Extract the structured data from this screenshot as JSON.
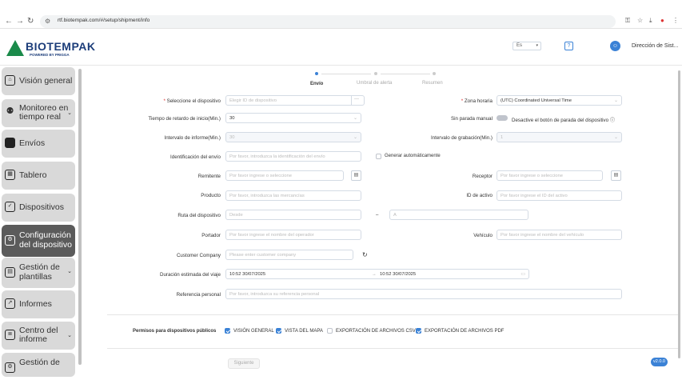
{
  "browser": {
    "url": "rtf.biotempak.com/#/setup/shipment/info"
  },
  "header": {
    "brand": "BIOTEMPAK",
    "tagline": "POWERED BY PRIGGA",
    "lang": "Es",
    "help": "?",
    "user": "Dirección de Sist..."
  },
  "sidebar": {
    "items": [
      {
        "label": "Visión general"
      },
      {
        "label": "Monitoreo en",
        "label2": "tiempo real"
      },
      {
        "label": "Envíos"
      },
      {
        "label": "Tablero"
      },
      {
        "label": "Dispositivos"
      },
      {
        "label": "Configuración",
        "label2": "del dispositivo"
      },
      {
        "label": "Gestión de",
        "label2": "plantillas"
      },
      {
        "label": "Informes"
      },
      {
        "label": "Centro del",
        "label2": "informe"
      },
      {
        "label": "Gestión de"
      }
    ]
  },
  "steps": [
    "Envío",
    "Umbral de alerta",
    "Resumen"
  ],
  "form": {
    "device_label": "Seleccione el dispositivo",
    "device_ph": "Elegir ID de dispositivo",
    "tz_label": "Zona horaria",
    "tz_val": "(UTC) Coordinated Universal Time",
    "delay_label": "Tiempo de retardo de inicio(Min.)",
    "delay_val": "30",
    "nostop_label": "Sin parada manual",
    "nostop_text": "Desactive el botón de parada del dispositivo",
    "report_label": "Intervalo de informe(Min.)",
    "report_val": "30",
    "record_label": "Intervalo de grabación(Min.)",
    "record_val": "1",
    "shipid_label": "Identificación del envío",
    "shipid_ph": "Por favor, introduzca la identificación del envío",
    "autogen": "Generar automáticamente",
    "sender_label": "Remitente",
    "sender_ph": "Por favor ingrese o seleccione",
    "receiver_label": "Receptor",
    "receiver_ph": "Por favor ingrese o seleccione",
    "product_label": "Producto",
    "product_ph": "Por favor, introduzca las mercancías",
    "asset_label": "ID de activo",
    "asset_ph": "Por favor ingrese el ID del activo",
    "route_label": "Ruta del dispositivo",
    "route_from": "Desde",
    "route_sep": "–",
    "route_to": "A",
    "carrier_label": "Portador",
    "carrier_ph": "Por favor ingrese el nombre del operador",
    "vehicle_label": "Vehículo",
    "vehicle_ph": "Por favor ingrese el nombre del vehículo",
    "company_label": "Customer Company",
    "company_ph": "Please enter customer company",
    "duration_label": "Duración estimada del viaje",
    "duration_start": "10:52 30/07/2025",
    "duration_sep": "→",
    "duration_end": "10:52 30/07/2025",
    "ref_label": "Referencia personal",
    "ref_ph": "Por favor, introduzca su referencia personal"
  },
  "permissions": {
    "label": "Permisos para dispositivos públicos",
    "items": [
      {
        "label": "VISIÓN GENERAL",
        "checked": true
      },
      {
        "label": "VISTA DEL MAPA",
        "checked": true
      },
      {
        "label": "EXPORTACIÓN DE ARCHIVOS CSV",
        "checked": false
      },
      {
        "label": "EXPORTACIÓN DE ARCHIVOS PDF",
        "checked": true
      }
    ]
  },
  "next": "Siguiente",
  "version": "v2.0.0",
  "colors": {
    "accent": "#3b82d6",
    "brand": "#1c3d7a",
    "logo_green": "#1a8a4a"
  }
}
